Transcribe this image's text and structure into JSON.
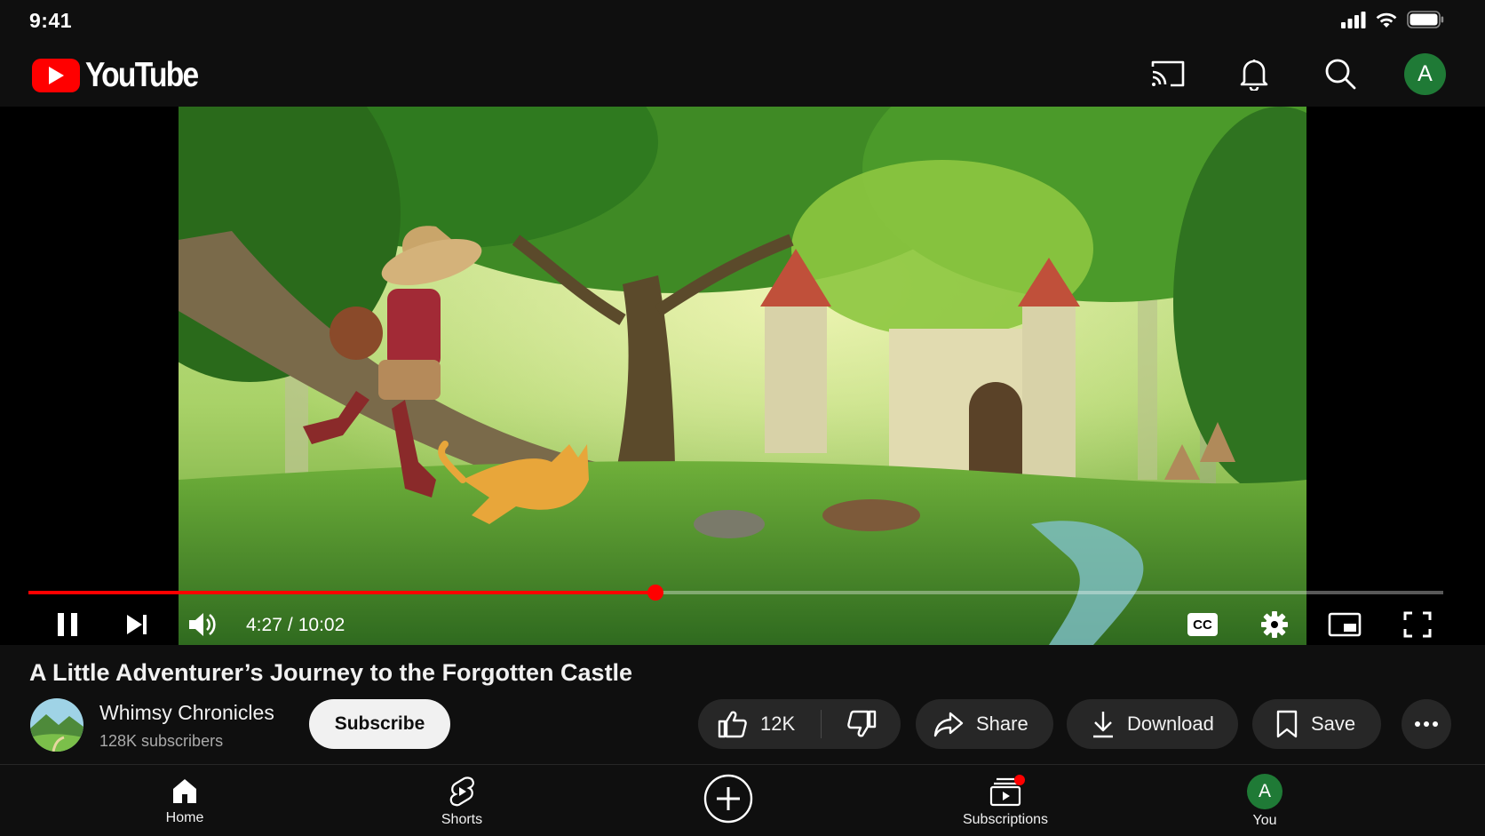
{
  "status_bar": {
    "time": "9:41"
  },
  "header": {
    "logo_text": "YouTube",
    "avatar_letter": "A",
    "icons": [
      "cast-icon",
      "bell-icon",
      "search-icon"
    ]
  },
  "player": {
    "current_time": "4:27",
    "separator": "/",
    "duration": "10:02",
    "progress_fraction": 0.443,
    "cc_label": "CC",
    "accent_color": "#ff0000"
  },
  "video": {
    "title": "A Little Adventurer’s Journey to the Forgotten Castle",
    "channel_name": "Whimsy Chronicles",
    "subscribers": "128K subscribers",
    "subscribe_label": "Subscribe",
    "like_count": "12K",
    "share_label": "Share",
    "download_label": "Download",
    "save_label": "Save"
  },
  "bottom_nav": {
    "items": [
      {
        "label": "Home",
        "icon": "home-icon"
      },
      {
        "label": "Shorts",
        "icon": "shorts-icon"
      },
      {
        "label": "",
        "icon": "create-plus-icon"
      },
      {
        "label": "Subscriptions",
        "icon": "subscriptions-icon"
      },
      {
        "label": "You",
        "icon": "avatar"
      }
    ],
    "avatar_letter": "A",
    "notification_color": "#ff0000"
  }
}
